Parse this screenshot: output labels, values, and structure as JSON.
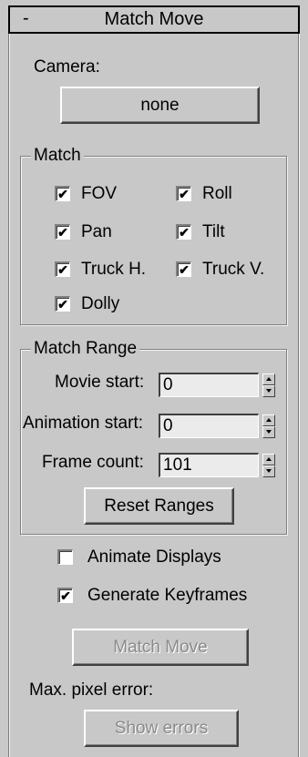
{
  "rollout": {
    "collapse_symbol": "-",
    "title": "Match Move"
  },
  "camera": {
    "label": "Camera:",
    "button_label": "none"
  },
  "match_group": {
    "title": "Match",
    "checkboxes": [
      {
        "label": "FOV",
        "checked": true
      },
      {
        "label": "Roll",
        "checked": true
      },
      {
        "label": "Pan",
        "checked": true
      },
      {
        "label": "Tilt",
        "checked": true
      },
      {
        "label": "Truck H.",
        "checked": true
      },
      {
        "label": "Truck V.",
        "checked": true
      },
      {
        "label": "Dolly",
        "checked": true
      }
    ]
  },
  "range_group": {
    "title": "Match Range",
    "movie_start": {
      "label": "Movie start:",
      "value": "0"
    },
    "animation_start": {
      "label": "Animation start:",
      "value": "0"
    },
    "frame_count": {
      "label": "Frame count:",
      "value": "101"
    },
    "reset_label": "Reset Ranges"
  },
  "options": {
    "animate_displays": {
      "label": "Animate Displays",
      "checked": false
    },
    "generate_keyframes": {
      "label": "Generate Keyframes",
      "checked": true
    }
  },
  "match_move_button": "Match Move",
  "max_pixel_error_label": "Max. pixel error:",
  "show_errors_button": "Show errors",
  "colors": {
    "background": "#c8c8c8",
    "disabled_text": "#8a8a8a",
    "field_bg": "#ebebeb"
  },
  "checkmark_glyph": "✔"
}
